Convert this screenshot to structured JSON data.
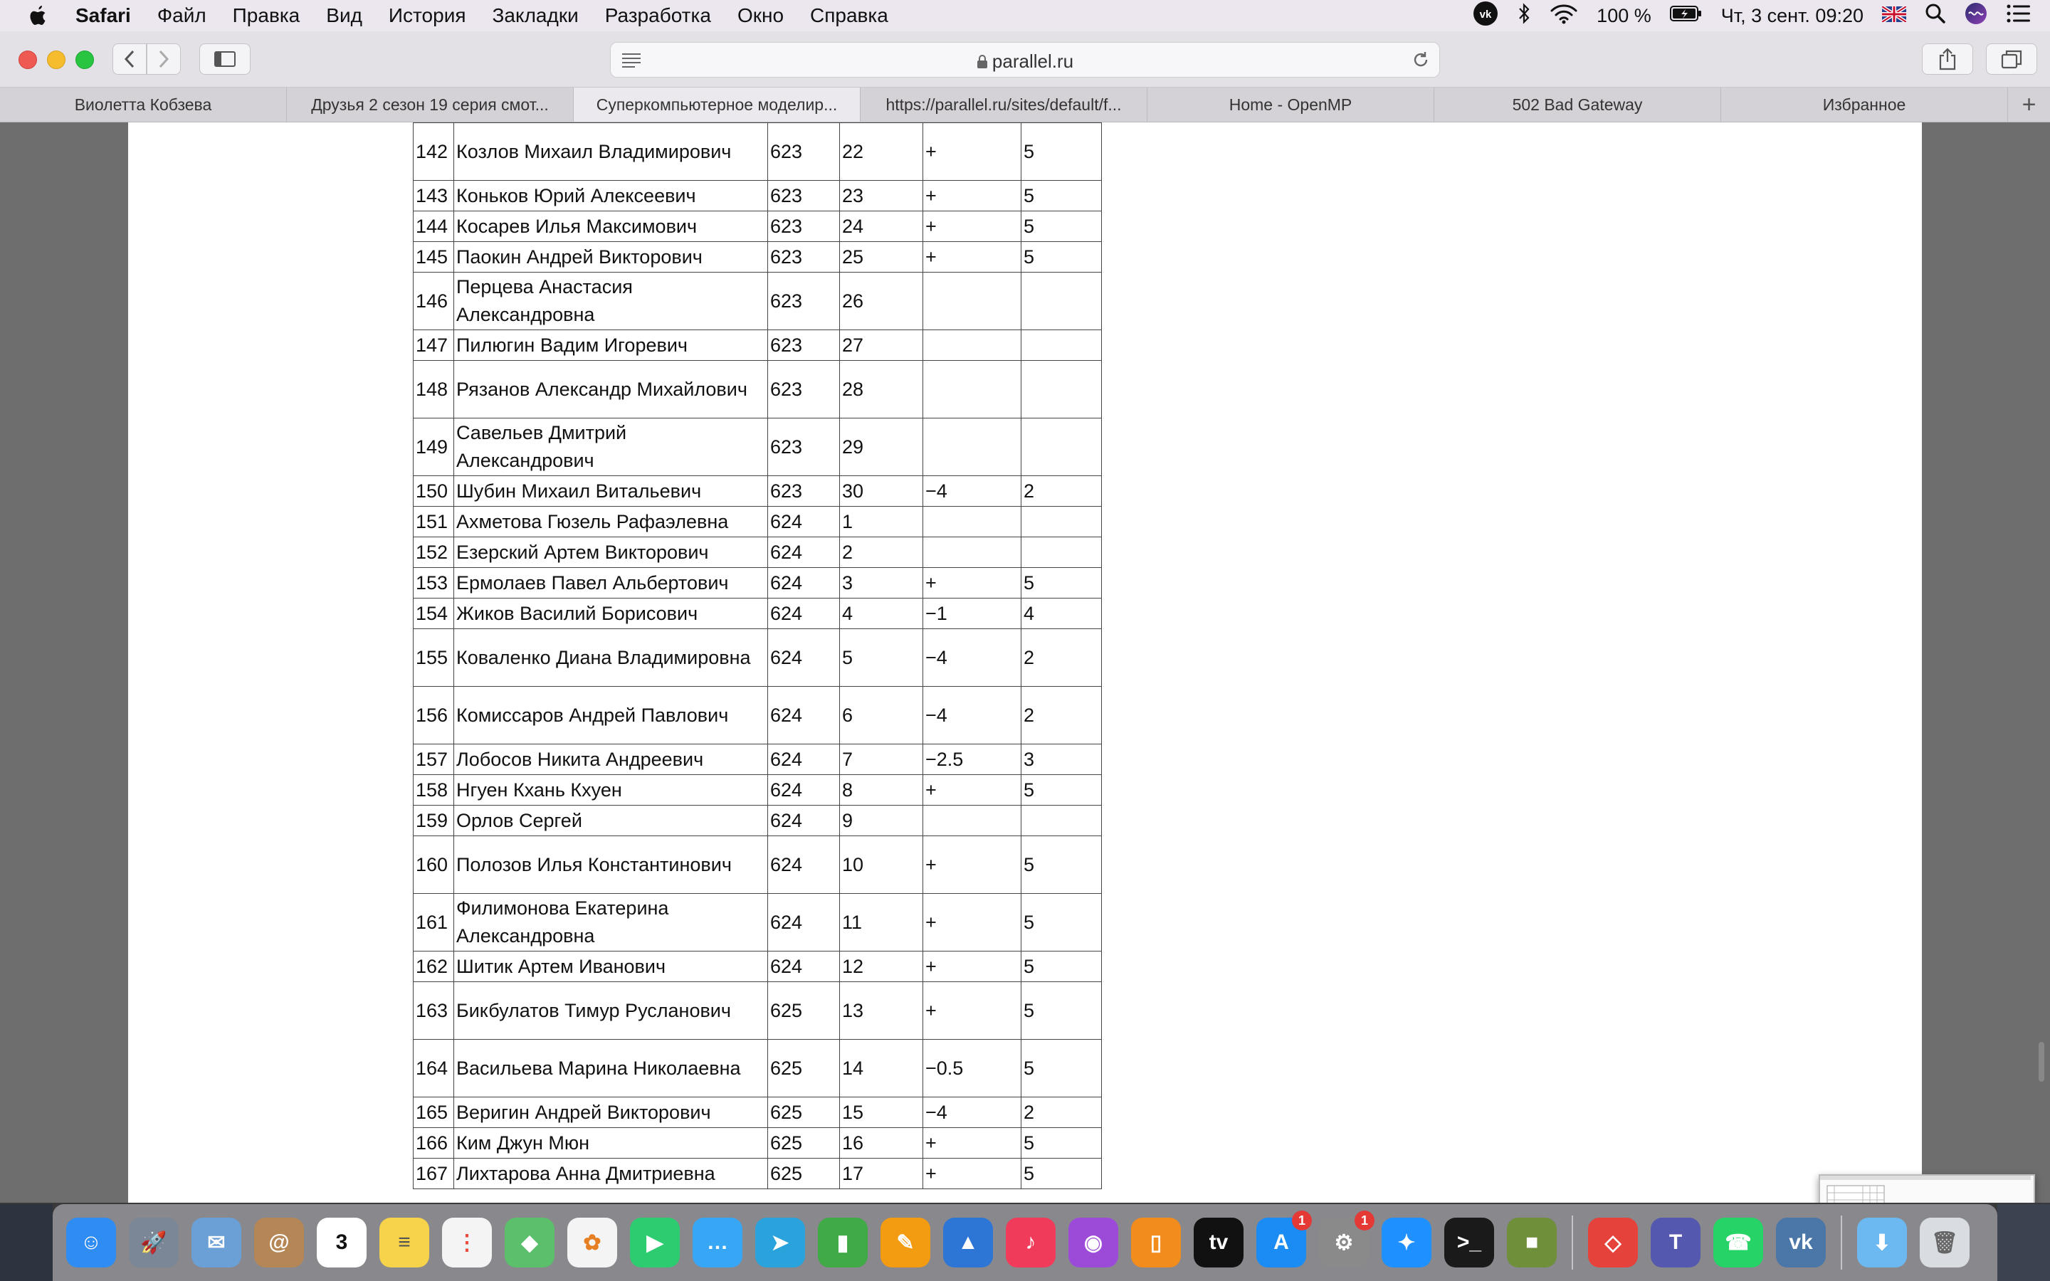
{
  "menubar": {
    "items": [
      "Safari",
      "Файл",
      "Правка",
      "Вид",
      "История",
      "Закладки",
      "Разработка",
      "Окно",
      "Справка"
    ],
    "battery": "100 %",
    "datetime": "Чт, 3 сент.  09:20"
  },
  "browser": {
    "url": "parallel.ru",
    "tabs": [
      "Виолетта Кобзева",
      "Друзья 2 сезон 19 серия смот...",
      "Суперкомпьютерное моделир...",
      "https://parallel.ru/sites/default/f...",
      "Home - OpenMP",
      "502 Bad Gateway",
      "Избранное"
    ],
    "active_tab": 2,
    "new_tab_label": "+"
  },
  "table": {
    "rows": [
      {
        "num": "142",
        "name": "Козлов Михаил Владимирович",
        "group": "623",
        "idx": "22",
        "mark": "+",
        "grade": "5",
        "tall": true
      },
      {
        "num": "143",
        "name": "Коньков Юрий Алексеевич",
        "group": "623",
        "idx": "23",
        "mark": "+",
        "grade": "5"
      },
      {
        "num": "144",
        "name": "Косарев Илья Максимович",
        "group": "623",
        "idx": "24",
        "mark": "+",
        "grade": "5"
      },
      {
        "num": "145",
        "name": "Паокин Андрей Викторович",
        "group": "623",
        "idx": "25",
        "mark": "+",
        "grade": "5"
      },
      {
        "num": "146",
        "name": "Перцева Анастасия Александровна",
        "group": "623",
        "idx": "26",
        "mark": "",
        "grade": "",
        "tall": true
      },
      {
        "num": "147",
        "name": "Пилюгин Вадим Игоревич",
        "group": "623",
        "idx": "27",
        "mark": "",
        "grade": ""
      },
      {
        "num": "148",
        "name": "Рязанов Александр Михайлович",
        "group": "623",
        "idx": "28",
        "mark": "",
        "grade": "",
        "tall": true
      },
      {
        "num": "149",
        "name": "Савельев Дмитрий Александрович",
        "group": "623",
        "idx": "29",
        "mark": "",
        "grade": "",
        "tall": true
      },
      {
        "num": "150",
        "name": "Шубин Михаил Витальевич",
        "group": "623",
        "idx": "30",
        "mark": "−4",
        "grade": "2"
      },
      {
        "num": "151",
        "name": "Ахметова Гюзель Рафаэлевна",
        "group": "624",
        "idx": "1",
        "mark": "",
        "grade": ""
      },
      {
        "num": "152",
        "name": "Езерский Артем Викторович",
        "group": "624",
        "idx": "2",
        "mark": "",
        "grade": ""
      },
      {
        "num": "153",
        "name": "Ермолаев Павел Альбертович",
        "group": "624",
        "idx": "3",
        "mark": "+",
        "grade": "5"
      },
      {
        "num": "154",
        "name": "Жиков Василий Борисович",
        "group": "624",
        "idx": "4",
        "mark": "−1",
        "grade": "4"
      },
      {
        "num": "155",
        "name": "Коваленко Диана Владимировна",
        "group": "624",
        "idx": "5",
        "mark": "−4",
        "grade": "2",
        "tall": true
      },
      {
        "num": "156",
        "name": "Комиссаров Андрей Павлович",
        "group": "624",
        "idx": "6",
        "mark": "−4",
        "grade": "2",
        "tall": true
      },
      {
        "num": "157",
        "name": "Лобосов Никита Андреевич",
        "group": "624",
        "idx": "7",
        "mark": "−2.5",
        "grade": "3"
      },
      {
        "num": "158",
        "name": "Нгуен Кхань Кхуен",
        "group": "624",
        "idx": "8",
        "mark": "+",
        "grade": "5"
      },
      {
        "num": "159",
        "name": "Орлов Сергей",
        "group": "624",
        "idx": "9",
        "mark": "",
        "grade": ""
      },
      {
        "num": "160",
        "name": "Полозов Илья Константинович",
        "group": "624",
        "idx": "10",
        "mark": "+",
        "grade": "5",
        "tall": true
      },
      {
        "num": "161",
        "name": "Филимонова Екатерина Александровна",
        "group": "624",
        "idx": "11",
        "mark": "+",
        "grade": "5",
        "tall": true
      },
      {
        "num": "162",
        "name": "Шитик Артем Иванович",
        "group": "624",
        "idx": "12",
        "mark": "+",
        "grade": "5"
      },
      {
        "num": "163",
        "name": "Бикбулатов Тимур Русланович",
        "group": "625",
        "idx": "13",
        "mark": "+",
        "grade": "5",
        "tall": true
      },
      {
        "num": "164",
        "name": "Васильева Марина Николаевна",
        "group": "625",
        "idx": "14",
        "mark": "−0.5",
        "grade": "5",
        "tall": true
      },
      {
        "num": "165",
        "name": "Веригин Андрей Викторович",
        "group": "625",
        "idx": "15",
        "mark": "−4",
        "grade": "2"
      },
      {
        "num": "166",
        "name": "Ким Джун Мюн",
        "group": "625",
        "idx": "16",
        "mark": "+",
        "grade": "5"
      },
      {
        "num": "167",
        "name": "Лихтарова Анна Дмитриевна",
        "group": "625",
        "idx": "17",
        "mark": "+",
        "grade": "5"
      }
    ]
  },
  "dock": {
    "apps": [
      {
        "name": "finder",
        "color": "#2f8cf2",
        "glyph": "☺"
      },
      {
        "name": "launchpad",
        "color": "#7b8797",
        "glyph": "🚀"
      },
      {
        "name": "mail-stamp",
        "color": "#6aa0d6",
        "glyph": "✉"
      },
      {
        "name": "contacts",
        "color": "#b58756",
        "glyph": "@"
      },
      {
        "name": "calendar",
        "color": "#ffffff",
        "glyph": "3",
        "text_color": "#111"
      },
      {
        "name": "notes",
        "color": "#f6d34a",
        "glyph": "≡",
        "text_color": "#555"
      },
      {
        "name": "reminders",
        "color": "#f4f4f4",
        "glyph": "⋮",
        "text_color": "#e74c3c"
      },
      {
        "name": "maps",
        "color": "#5cbf6b",
        "glyph": "◆"
      },
      {
        "name": "photos",
        "color": "#f4f4f4",
        "glyph": "✿",
        "text_color": "#e67e22"
      },
      {
        "name": "facetime",
        "color": "#2ecc71",
        "glyph": "▶"
      },
      {
        "name": "messages",
        "color": "#37a6f5",
        "glyph": "…"
      },
      {
        "name": "telegram",
        "color": "#2aa3dd",
        "glyph": "➤"
      },
      {
        "name": "numbers",
        "color": "#3faa46",
        "glyph": "▮"
      },
      {
        "name": "pages",
        "color": "#f39c12",
        "glyph": "✎"
      },
      {
        "name": "keynote",
        "color": "#2d76d6",
        "glyph": "▲"
      },
      {
        "name": "music",
        "color": "#f03c5a",
        "glyph": "♪"
      },
      {
        "name": "podcasts",
        "color": "#9b4bd8",
        "glyph": "◉"
      },
      {
        "name": "books",
        "color": "#f28c1c",
        "glyph": "▯"
      },
      {
        "name": "apple-tv",
        "color": "#111111",
        "glyph": "tv"
      },
      {
        "name": "app-store",
        "color": "#1b8cf3",
        "glyph": "A",
        "badge": "1"
      },
      {
        "name": "system-preferences",
        "color": "#8a8a8a",
        "glyph": "⚙",
        "badge": "1"
      },
      {
        "name": "safari",
        "color": "#1e90ff",
        "glyph": "✦"
      },
      {
        "name": "terminal",
        "color": "#1a1a1a",
        "glyph": ">_"
      },
      {
        "name": "minecraft",
        "color": "#6f8f3a",
        "glyph": "■"
      },
      {
        "name": "anydesk",
        "color": "#e5423b",
        "glyph": "◇"
      },
      {
        "name": "teams",
        "color": "#5558af",
        "glyph": "T"
      },
      {
        "name": "whatsapp",
        "color": "#25d366",
        "glyph": "☎"
      },
      {
        "name": "vk",
        "color": "#4a76a8",
        "glyph": "vk"
      },
      {
        "name": "downloads-folder",
        "color": "#6cb8f0",
        "glyph": "⬇"
      },
      {
        "name": "trash",
        "color": "#d9dde2",
        "glyph": "🗑",
        "text_color": "#666"
      }
    ]
  }
}
